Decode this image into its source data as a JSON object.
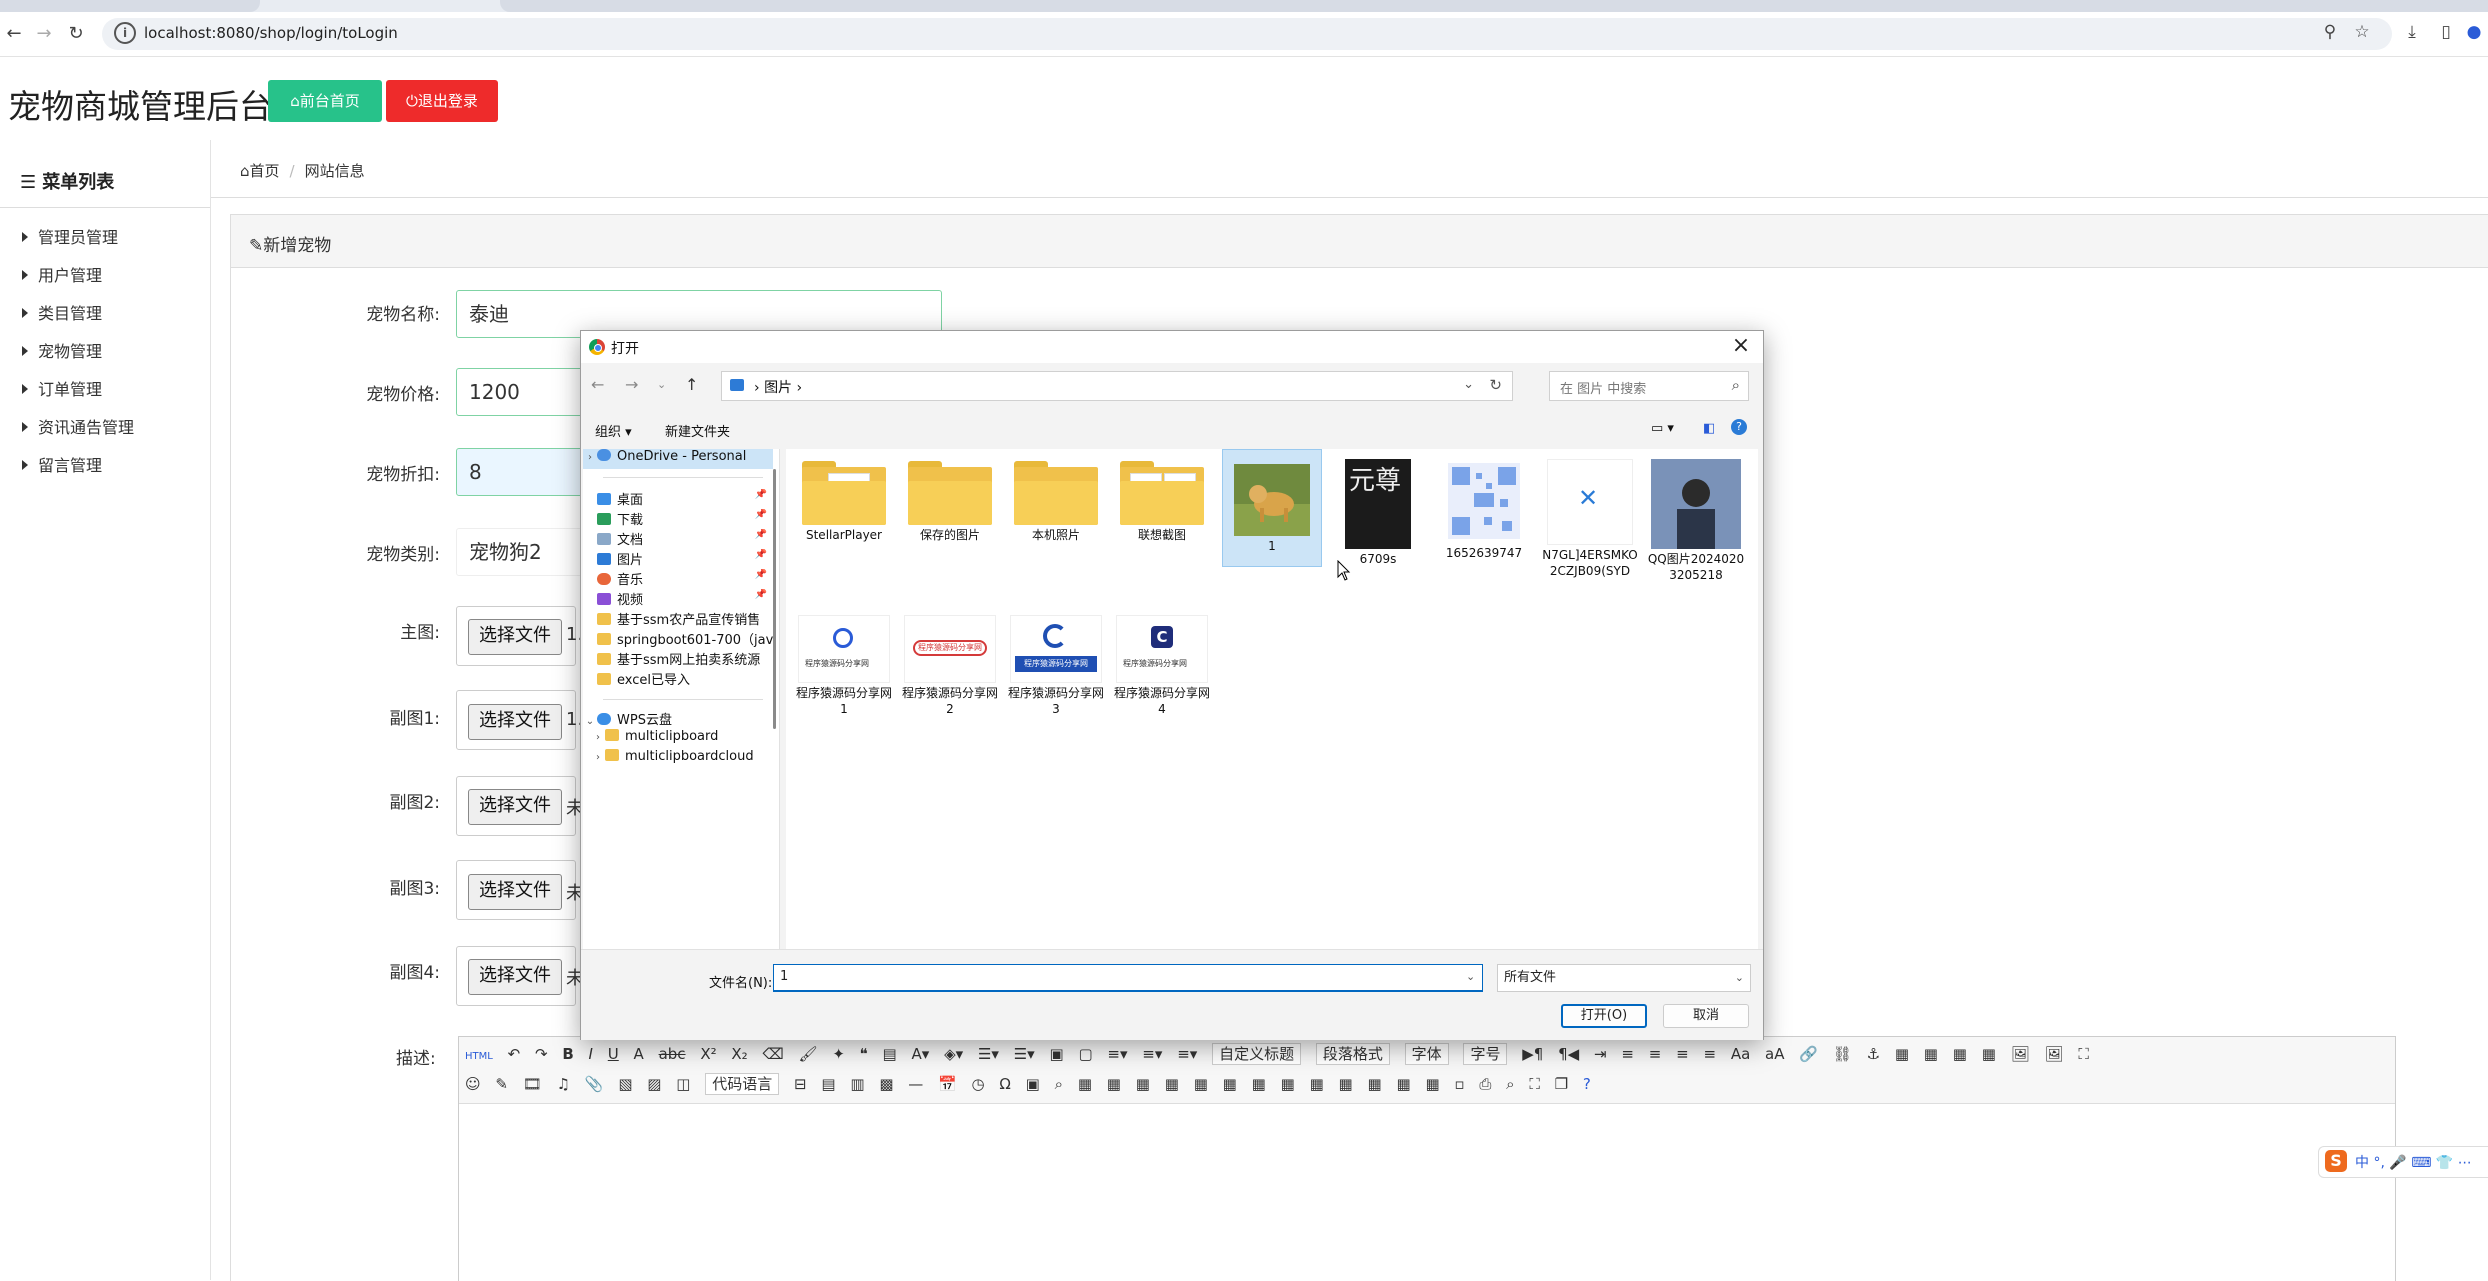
{
  "browser": {
    "url": "localhost:8080/shop/login/toLogin"
  },
  "header": {
    "title": "宠物商城管理后台",
    "front_btn": "前台首页",
    "logout_btn": "退出登录"
  },
  "sidebar": {
    "title": "菜单列表",
    "items": [
      "管理员管理",
      "用户管理",
      "类目管理",
      "宠物管理",
      "订单管理",
      "资讯通告管理",
      "留言管理"
    ]
  },
  "breadcrumb": [
    "首页",
    "网站信息"
  ],
  "panel": {
    "title": "新增宠物",
    "fields": {
      "name_label": "宠物名称:",
      "name_value": "泰迪",
      "price_label": "宠物价格:",
      "price_value": "1200",
      "discount_label": "宠物折扣:",
      "discount_value": "8",
      "category_label": "宠物类别:",
      "category_value": "宠物狗2",
      "main_img_label": "主图:",
      "sub1_label": "副图1:",
      "sub2_label": "副图2:",
      "sub3_label": "副图3:",
      "sub4_label": "副图4:",
      "desc_label": "描述:",
      "choose_file": "选择文件",
      "main_file_text": "1.",
      "sub1_file_text": "1.",
      "sub2_file_text": "未",
      "sub3_file_text": "未",
      "sub4_file_text": "未"
    },
    "editor": {
      "html_btn": "HTML",
      "sel_title": "自定义标题",
      "sel_para": "段落格式",
      "sel_font": "字体",
      "sel_size": "字号",
      "sel_code": "代码语言"
    }
  },
  "dialog": {
    "title": "打开",
    "path": [
      "图片",
      "›"
    ],
    "search_placeholder": "在 图片 中搜索",
    "organize": "组织 ▾",
    "new_folder": "新建文件夹",
    "nav": {
      "onedrive": "OneDrive - Personal",
      "desktop": "桌面",
      "downloads": "下载",
      "documents": "文档",
      "pictures": "图片",
      "music": "音乐",
      "videos": "视频",
      "f1": "基于ssm农产品宣传销售",
      "f2": "springboot601-700（jav",
      "f3": "基于ssm网上拍卖系统源",
      "f4": "excel已导入",
      "wps": "WPS云盘",
      "mc": "multiclipboard",
      "mcc": "multiclipboardcloud"
    },
    "files_row1": [
      "StellarPlayer",
      "保存的图片",
      "本机照片",
      "联想截图",
      "1",
      "6709s",
      "1652639747",
      "N7GL]4ERSMKO2CZJB09(SYD",
      "QQ图片20240203205218"
    ],
    "files_row2": [
      "程序猿源码分享网1",
      "程序猿源码分享网2",
      "程序猿源码分享网3",
      "程序猿源码分享网4"
    ],
    "thumb_texts": {
      "dark_title": "元尊",
      "watermark": "程序猿源码分享网"
    },
    "filename_label": "文件名(N):",
    "filename_value": "1",
    "filetype": "所有文件",
    "open_btn": "打开(O)",
    "cancel_btn": "取消"
  },
  "ime": {
    "logo": "S",
    "items": "中 °, 🎤 ⌨ 👕 ⋯"
  },
  "colors": {
    "green": "#27c28a",
    "red": "#ee2b2b",
    "accent": "#0067c0"
  }
}
